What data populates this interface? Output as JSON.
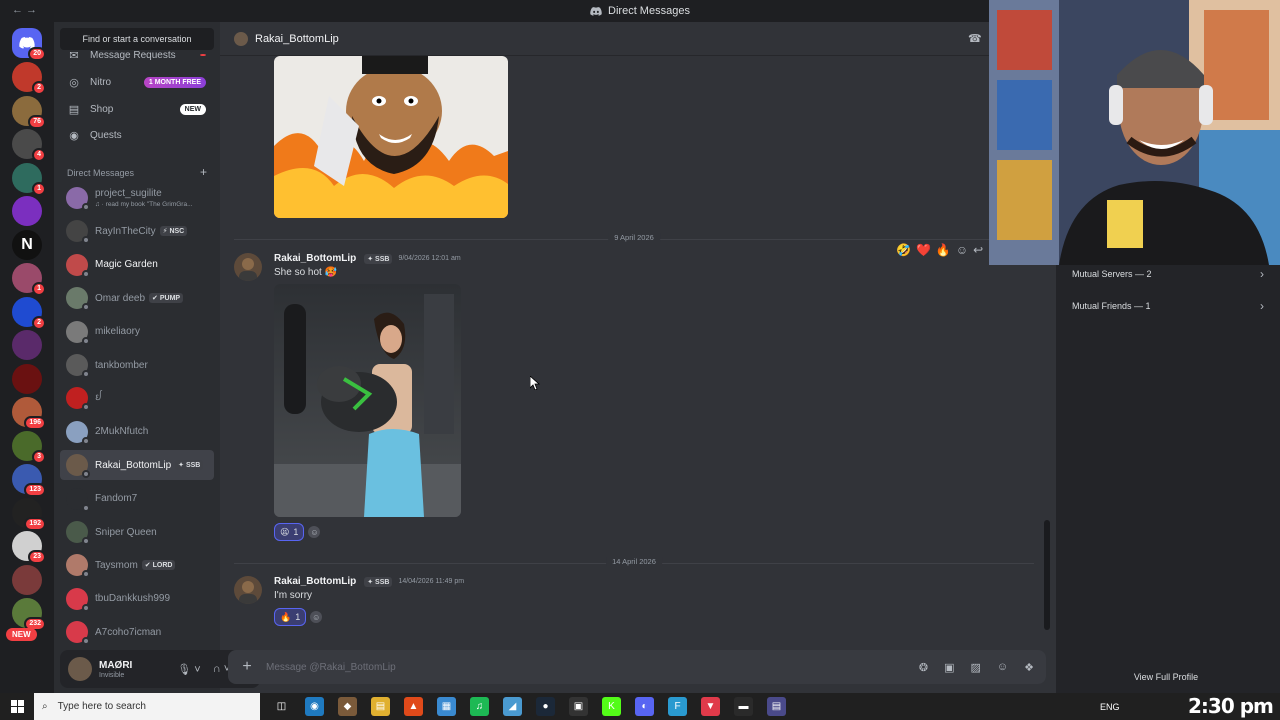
{
  "titlebar": {
    "title": "Direct Messages",
    "back_icon": "←  →"
  },
  "server_rail": {
    "home_badge": "20",
    "servers": [
      {
        "badge": "2",
        "color": "#c0392b"
      },
      {
        "badge": "76",
        "color": "#8b6b3d"
      },
      {
        "badge": "4",
        "color": "#4a4a4a"
      },
      {
        "badge": "1",
        "color": "#2e6b5e"
      },
      {
        "badge": "",
        "color": "#7b2fbf"
      },
      {
        "badge": "",
        "color": "#111111",
        "letter": "N"
      },
      {
        "badge": "1",
        "color": "#9a4a6a"
      },
      {
        "badge": "2",
        "color": "#1f4bd1"
      },
      {
        "badge": "",
        "color": "#5a2a6a"
      },
      {
        "badge": "",
        "color": "#6a1111"
      },
      {
        "badge": "196",
        "color": "#b05a3a"
      },
      {
        "badge": "3",
        "color": "#4a6a2a"
      },
      {
        "badge": "123",
        "color": "#3a5ab0"
      },
      {
        "badge": "192",
        "color": "#222222"
      },
      {
        "badge": "23",
        "color": "#d0d0d0"
      },
      {
        "badge": "",
        "color": "#7a3a3a"
      },
      {
        "badge": "232",
        "color": "#5a7a3a"
      }
    ],
    "new_label": "NEW"
  },
  "dm_panel": {
    "search_label": "Find or start a conversation",
    "nav": [
      {
        "label": "Message Requests",
        "icon": "✉",
        "pill": "",
        "pill_type": "req"
      },
      {
        "label": "Nitro",
        "icon": "◎",
        "pill": "1 MONTH FREE",
        "pill_type": "nitro"
      },
      {
        "label": "Shop",
        "icon": "▤",
        "pill": "NEW",
        "pill_type": "new"
      },
      {
        "label": "Quests",
        "icon": "◉",
        "pill": "",
        "pill_type": ""
      }
    ],
    "dm_header": "Direct Messages",
    "dm_plus": "+",
    "dms": [
      {
        "name": "project_sugilite",
        "sub": "♫ · read my book \"The GrimGra...",
        "tag": "",
        "color": "#8a6aa8"
      },
      {
        "name": "RayInTheCity",
        "sub": "",
        "tag": "⚡ NSC",
        "color": "#444"
      },
      {
        "name": "Magic Garden",
        "sub": "",
        "tag": "",
        "color": "#c04a4a",
        "bold": true
      },
      {
        "name": "Omar deeb",
        "sub": "",
        "tag": "✔ PUMP",
        "color": "#6a7a6a"
      },
      {
        "name": "mikeliaory",
        "sub": "",
        "tag": "",
        "color": "#7a7a7a"
      },
      {
        "name": "tankbomber",
        "sub": "",
        "tag": "",
        "color": "#5a5a5a"
      },
      {
        "name": "ᩀ",
        "sub": "",
        "tag": "",
        "color": "#c02020"
      },
      {
        "name": "2MukNfutch",
        "sub": "",
        "tag": "",
        "color": "#8aa0c0"
      },
      {
        "name": "Rakai_BottomLip",
        "sub": "",
        "tag": "✦ SSB",
        "color": "#6b5a4a",
        "active": true
      },
      {
        "name": "Fandom7",
        "sub": "",
        "tag": "",
        "color": "#2b2d31"
      },
      {
        "name": "Sniper Queen",
        "sub": "",
        "tag": "",
        "color": "#4a5a4a"
      },
      {
        "name": "Taysmom",
        "sub": "",
        "tag": "✔ LORD",
        "color": "#b07a6a"
      },
      {
        "name": "tbuDankkush999",
        "sub": "",
        "tag": "",
        "color": "#d83a4a"
      },
      {
        "name": "A7coho7icman",
        "sub": "",
        "tag": "",
        "color": "#d83a4a"
      }
    ],
    "user": {
      "name": "MAØRI",
      "status": "Invisible",
      "mic": "🎙︎ ˅",
      "headset": "∩ ˅",
      "settings": "⚙"
    }
  },
  "chat": {
    "header_name": "Rakai_BottomLip",
    "call_icon": "☎",
    "dividers": [
      "9 April 2026",
      "14 April 2026"
    ],
    "messages": [
      {
        "author": "Rakai_BottomLip",
        "tag": "✦ SSB",
        "time": "9/04/2026 12:01 am",
        "text": "She so hot 🥵",
        "reaction": "😫",
        "count": "1"
      },
      {
        "author": "Rakai_BottomLip",
        "tag": "✦ SSB",
        "time": "14/04/2026 11:49 pm",
        "text": "I'm sorry",
        "reaction": "🔥",
        "count": "1"
      }
    ],
    "hover_reactions": [
      "🤣",
      "❤️",
      "🔥",
      "☺",
      "↩"
    ],
    "composer_placeholder": "Message @Rakai_BottomLip",
    "composer_plus": "+",
    "composer_tools": [
      "❂",
      "▣",
      "▨",
      "☺",
      "❖"
    ]
  },
  "right_panel": {
    "rows": [
      {
        "label": "Mutual Servers — 2"
      },
      {
        "label": "Mutual Friends — 1"
      }
    ],
    "view_full_profile": "View Full Profile"
  },
  "taskbar": {
    "search_placeholder": "Type here to search",
    "apps": [
      {
        "name": "task-view",
        "glyph": "◫",
        "color": "transparent"
      },
      {
        "name": "edge",
        "glyph": "◉",
        "color": "#1f7ac0"
      },
      {
        "name": "app-3",
        "glyph": "◆",
        "color": "#7a5a3a"
      },
      {
        "name": "explorer",
        "glyph": "▤",
        "color": "#e0b030"
      },
      {
        "name": "brave",
        "glyph": "▲",
        "color": "#e04a1a"
      },
      {
        "name": "store",
        "glyph": "▦",
        "color": "#3a8ad0"
      },
      {
        "name": "spotify",
        "glyph": "♫",
        "color": "#1db954"
      },
      {
        "name": "app-8",
        "glyph": "◢",
        "color": "#4a9ad0"
      },
      {
        "name": "steam",
        "glyph": "●",
        "color": "#1b2838"
      },
      {
        "name": "app-10",
        "glyph": "▣",
        "color": "#333"
      },
      {
        "name": "kick",
        "glyph": "K",
        "color": "#53fc18"
      },
      {
        "name": "discord",
        "glyph": "◐",
        "color": "#5865f2"
      },
      {
        "name": "app-13",
        "glyph": "F",
        "color": "#2a9ad0"
      },
      {
        "name": "valorant",
        "glyph": "▼",
        "color": "#e03a4a"
      },
      {
        "name": "app-15",
        "glyph": "▬",
        "color": "#2a2a2a"
      },
      {
        "name": "app-16",
        "glyph": "▤",
        "color": "#4a4a8a"
      }
    ],
    "tray_text": "ENG",
    "clock": "2:30 pm"
  },
  "watermark": "MAØRI"
}
